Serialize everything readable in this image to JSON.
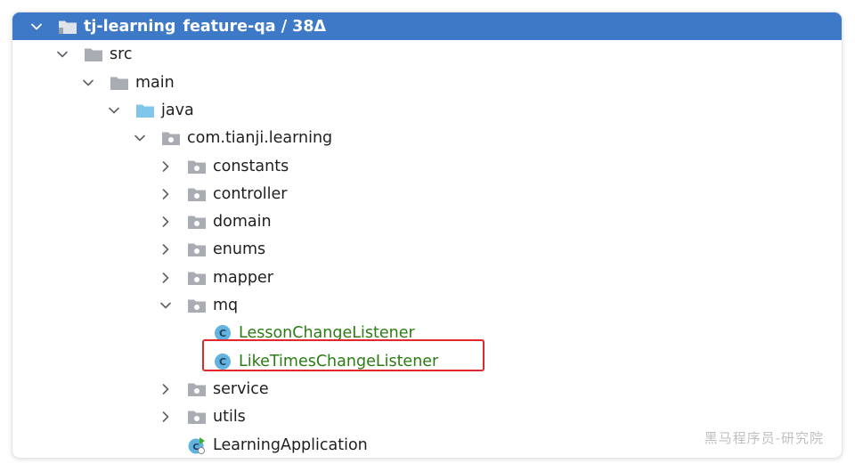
{
  "tree": {
    "root": {
      "name": "tj-learning",
      "branch": "feature-qa / 38Δ"
    },
    "items": [
      {
        "label": "src",
        "indent": 1,
        "expanded": true,
        "icon": "folder-gray"
      },
      {
        "label": "main",
        "indent": 2,
        "expanded": true,
        "icon": "folder-gray"
      },
      {
        "label": "java",
        "indent": 3,
        "expanded": true,
        "icon": "folder-blue"
      },
      {
        "label": "com.tianji.learning",
        "indent": 4,
        "expanded": true,
        "icon": "package"
      },
      {
        "label": "constants",
        "indent": 5,
        "expanded": false,
        "icon": "package"
      },
      {
        "label": "controller",
        "indent": 5,
        "expanded": false,
        "icon": "package"
      },
      {
        "label": "domain",
        "indent": 5,
        "expanded": false,
        "icon": "package"
      },
      {
        "label": "enums",
        "indent": 5,
        "expanded": false,
        "icon": "package"
      },
      {
        "label": "mapper",
        "indent": 5,
        "expanded": false,
        "icon": "package"
      },
      {
        "label": "mq",
        "indent": 5,
        "expanded": true,
        "icon": "package"
      },
      {
        "label": "LessonChangeListener",
        "indent": 6,
        "expanded": null,
        "icon": "class",
        "modified": true
      },
      {
        "label": "LikeTimesChangeListener",
        "indent": 6,
        "expanded": null,
        "icon": "class",
        "modified": true,
        "highlighted": true
      },
      {
        "label": "service",
        "indent": 5,
        "expanded": false,
        "icon": "package"
      },
      {
        "label": "utils",
        "indent": 5,
        "expanded": false,
        "icon": "package"
      },
      {
        "label": "LearningApplication",
        "indent": 5,
        "expanded": null,
        "icon": "spring-class"
      }
    ]
  },
  "watermark": "黑马程序员-研究院",
  "colors": {
    "selection": "#3d79c6",
    "modified_text": "#2a7d13",
    "highlight_border": "#e0282d",
    "folder_gray": "#a9adb3",
    "folder_blue": "#7fc6ea",
    "class_icon": "#62b3df"
  }
}
